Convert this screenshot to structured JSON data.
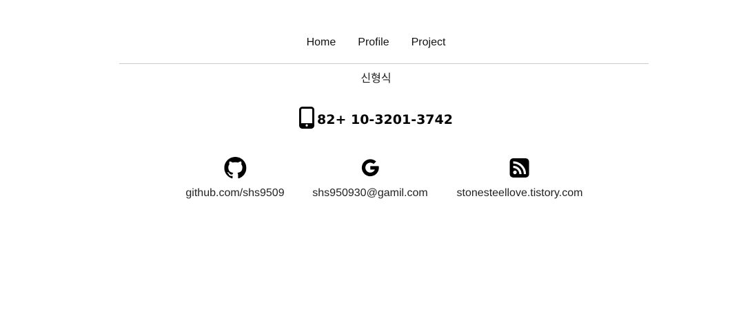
{
  "nav": {
    "items": [
      "Home",
      "Profile",
      "Project"
    ]
  },
  "profile": {
    "name": "신형식",
    "phone": "82+ 10-3201-3742",
    "phone_icon": "mobile-phone-icon"
  },
  "contacts": [
    {
      "icon": "github-icon",
      "label": "github.com/shs9509"
    },
    {
      "icon": "google-icon",
      "label": "shs950930@gamil.com"
    },
    {
      "icon": "rss-icon",
      "label": "stonesteellove.tistory.com"
    }
  ],
  "colors": {
    "background": "#ffffff",
    "text": "#111111",
    "divider": "#cccccc"
  }
}
